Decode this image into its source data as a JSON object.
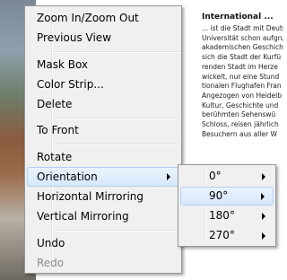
{
  "document": {
    "heading": "International ...",
    "lines": [
      "... ist die Stadt mit Deuts",
      "Universität schon aufgru",
      "akademischen Geschicht",
      "sich die Stadt der Kurfü",
      "renden Stadt im Herze",
      "wickelt, nur eine Stund",
      "tionalen Flughafen Fran",
      "Angezogen von Heidelb",
      "Kultur, Geschichte und",
      "berühmten Sehenswü",
      "Schloss, reisen jährlich",
      "Besuchern aus aller W"
    ]
  },
  "context_menu": {
    "items": [
      {
        "label": "Zoom In/Zoom Out"
      },
      {
        "label": "Previous View"
      },
      {
        "label": "Mask Box"
      },
      {
        "label": "Color Strip..."
      },
      {
        "label": "Delete"
      },
      {
        "label": "To Front"
      },
      {
        "label": "Rotate"
      },
      {
        "label": "Orientation"
      },
      {
        "label": "Horizontal Mirroring"
      },
      {
        "label": "Vertical Mirroring"
      },
      {
        "label": "Undo"
      },
      {
        "label": "Redo"
      }
    ]
  },
  "orientation_submenu": {
    "items": [
      {
        "label": "0°"
      },
      {
        "label": "90°"
      },
      {
        "label": "180°"
      },
      {
        "label": "270°"
      }
    ]
  }
}
